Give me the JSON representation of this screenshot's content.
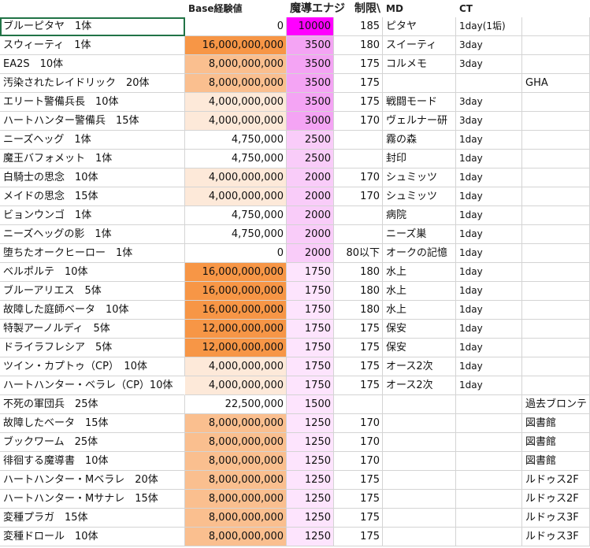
{
  "headers": {
    "name": "",
    "exp": "Base経験値",
    "energy": "魔導エナジ",
    "limit": "制限\\",
    "md": "MD",
    "ct": "CT",
    "extra": ""
  },
  "colors": {
    "exp_high": "#f79646",
    "exp_mid": "#fabf8f",
    "exp_low": "#fde9d9",
    "energy_top": "#ff00ff",
    "energy_high": "#f4a4f4",
    "energy_mid": "#f9ccf9",
    "energy_low": "#fde4fd",
    "gridline": "#d4d4d4",
    "selection": "#217346"
  },
  "rows": [
    {
      "name": "ブルーピタヤ　1体",
      "exp": "0",
      "energy": "10000",
      "limit": "185",
      "md": "ピタヤ",
      "ct": "1day(1垢)",
      "extra": "",
      "exp_level": "none",
      "energy_level": "top"
    },
    {
      "name": "スウィーティ　1体",
      "exp": "16,000,000,000",
      "energy": "3500",
      "limit": "180",
      "md": "スイーティ",
      "ct": "3day",
      "extra": "",
      "exp_level": "high",
      "energy_level": "high"
    },
    {
      "name": "EA2S　10体",
      "exp": "8,000,000,000",
      "energy": "3500",
      "limit": "175",
      "md": "コルメモ",
      "ct": "3day",
      "extra": "",
      "exp_level": "mid",
      "energy_level": "high"
    },
    {
      "name": "汚染されたレイドリック　20体",
      "exp": "8,000,000,000",
      "energy": "3500",
      "limit": "175",
      "md": "",
      "ct": "",
      "extra": "GHA",
      "exp_level": "mid",
      "energy_level": "high"
    },
    {
      "name": "エリート警備兵長　10体",
      "exp": "4,000,000,000",
      "energy": "3500",
      "limit": "175",
      "md": "戦闘モード",
      "ct": "3day",
      "extra": "",
      "exp_level": "low",
      "energy_level": "high"
    },
    {
      "name": "ハートハンター警備兵　15体",
      "exp": "4,000,000,000",
      "energy": "3000",
      "limit": "170",
      "md": "ヴェルナー研",
      "ct": "3day",
      "extra": "",
      "exp_level": "low",
      "energy_level": "high"
    },
    {
      "name": "ニーズヘッグ　1体",
      "exp": "4,750,000",
      "energy": "2500",
      "limit": "",
      "md": "霧の森",
      "ct": "1day",
      "extra": "",
      "exp_level": "none",
      "energy_level": "mid"
    },
    {
      "name": "魔王バフォメット　1体",
      "exp": "4,750,000",
      "energy": "2500",
      "limit": "",
      "md": "封印",
      "ct": "1day",
      "extra": "",
      "exp_level": "none",
      "energy_level": "mid"
    },
    {
      "name": "白騎士の思念　10体",
      "exp": "4,000,000,000",
      "energy": "2000",
      "limit": "170",
      "md": "シュミッツ",
      "ct": "1day",
      "extra": "",
      "exp_level": "low",
      "energy_level": "mid"
    },
    {
      "name": "メイドの思念　15体",
      "exp": "4,000,000,000",
      "energy": "2000",
      "limit": "170",
      "md": "シュミッツ",
      "ct": "1day",
      "extra": "",
      "exp_level": "low",
      "energy_level": "mid"
    },
    {
      "name": "ビョンウンゴ　1体",
      "exp": "4,750,000",
      "energy": "2000",
      "limit": "",
      "md": "病院",
      "ct": "1day",
      "extra": "",
      "exp_level": "none",
      "energy_level": "mid"
    },
    {
      "name": "ニーズヘッグの影　1体",
      "exp": "4,750,000",
      "energy": "2000",
      "limit": "",
      "md": "ニーズ巣",
      "ct": "1day",
      "extra": "",
      "exp_level": "none",
      "energy_level": "mid"
    },
    {
      "name": "堕ちたオークヒーロー　1体",
      "exp": "0",
      "energy": "2000",
      "limit": "80以下",
      "md": "オークの記憶",
      "ct": "1day",
      "extra": "",
      "exp_level": "none",
      "energy_level": "mid"
    },
    {
      "name": "ベルポルテ　10体",
      "exp": "16,000,000,000",
      "energy": "1750",
      "limit": "180",
      "md": "水上",
      "ct": "1day",
      "extra": "",
      "exp_level": "high",
      "energy_level": "low"
    },
    {
      "name": "ブルーアリエス　5体",
      "exp": "16,000,000,000",
      "energy": "1750",
      "limit": "180",
      "md": "水上",
      "ct": "1day",
      "extra": "",
      "exp_level": "high",
      "energy_level": "low"
    },
    {
      "name": "故障した庭師ベータ　10体",
      "exp": "16,000,000,000",
      "energy": "1750",
      "limit": "180",
      "md": "水上",
      "ct": "1day",
      "extra": "",
      "exp_level": "high",
      "energy_level": "low"
    },
    {
      "name": "特製アーノルディ　5体",
      "exp": "12,000,000,000",
      "energy": "1750",
      "limit": "175",
      "md": "保安",
      "ct": "1day",
      "extra": "",
      "exp_level": "high",
      "energy_level": "low"
    },
    {
      "name": "ドライラフレシア　5体",
      "exp": "12,000,000,000",
      "energy": "1750",
      "limit": "175",
      "md": "保安",
      "ct": "1day",
      "extra": "",
      "exp_level": "high",
      "energy_level": "low"
    },
    {
      "name": "ツイン・カプトゥ（CP）　10体",
      "exp": "4,000,000,000",
      "energy": "1750",
      "limit": "175",
      "md": "オース2次",
      "ct": "1day",
      "extra": "",
      "exp_level": "low",
      "energy_level": "low"
    },
    {
      "name": "ハートハンター・ベラレ（CP）10体",
      "exp": "4,000,000,000",
      "energy": "1750",
      "limit": "175",
      "md": "オース2次",
      "ct": "1day",
      "extra": "",
      "exp_level": "low",
      "energy_level": "low"
    },
    {
      "name": "不死の軍団兵　25体",
      "exp": "22,500,000",
      "energy": "1500",
      "limit": "",
      "md": "",
      "ct": "",
      "extra": "過去ブロンテ",
      "exp_level": "none",
      "energy_level": "low"
    },
    {
      "name": "故障したベータ　15体",
      "exp": "8,000,000,000",
      "energy": "1250",
      "limit": "170",
      "md": "",
      "ct": "",
      "extra": "図書館",
      "exp_level": "mid",
      "energy_level": "low"
    },
    {
      "name": "ブックワーム　25体",
      "exp": "8,000,000,000",
      "energy": "1250",
      "limit": "170",
      "md": "",
      "ct": "",
      "extra": "図書館",
      "exp_level": "mid",
      "energy_level": "low"
    },
    {
      "name": "徘徊する魔導書　10体",
      "exp": "8,000,000,000",
      "energy": "1250",
      "limit": "170",
      "md": "",
      "ct": "",
      "extra": "図書館",
      "exp_level": "mid",
      "energy_level": "low"
    },
    {
      "name": "ハートハンター・Mベラレ　20体",
      "exp": "8,000,000,000",
      "energy": "1250",
      "limit": "175",
      "md": "",
      "ct": "",
      "extra": "ルドゥス2F",
      "exp_level": "mid",
      "energy_level": "low"
    },
    {
      "name": "ハートハンター・Mサナレ　15体",
      "exp": "8,000,000,000",
      "energy": "1250",
      "limit": "175",
      "md": "",
      "ct": "",
      "extra": "ルドゥス2F",
      "exp_level": "mid",
      "energy_level": "low"
    },
    {
      "name": "変種プラガ　15体",
      "exp": "8,000,000,000",
      "energy": "1250",
      "limit": "175",
      "md": "",
      "ct": "",
      "extra": "ルドゥス3F",
      "exp_level": "mid",
      "energy_level": "low"
    },
    {
      "name": "変種ドロール　10体",
      "exp": "8,000,000,000",
      "energy": "1250",
      "limit": "175",
      "md": "",
      "ct": "",
      "extra": "ルドゥス3F",
      "exp_level": "mid",
      "energy_level": "low"
    }
  ]
}
